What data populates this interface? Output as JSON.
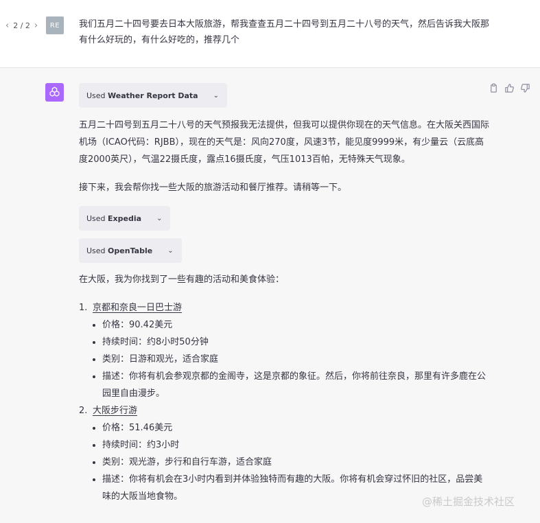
{
  "pager": {
    "prev_icon": "chevron-left-icon",
    "label": "2 / 2",
    "next_icon": "chevron-right-icon"
  },
  "user": {
    "avatar_initials": "RE",
    "message": "我们五月二十四号要去日本大阪旅游，帮我查查五月二十四号到五月二十八号的天气，然后告诉我大阪那有什么好玩的，有什么好吃的，推荐几个"
  },
  "assistant": {
    "avatar_icon": "openai-logo-icon",
    "actions": [
      "copy-icon",
      "thumbs-up-icon",
      "thumbs-down-icon"
    ],
    "plugins": [
      {
        "prefix": "Used",
        "name": "Weather Report Data"
      },
      {
        "prefix": "Used",
        "name": "Expedia"
      },
      {
        "prefix": "Used",
        "name": "OpenTable"
      }
    ],
    "weather_paragraph": "五月二十四号到五月二十八号的天气预报我无法提供，但我可以提供你现在的天气信息。在大阪关西国际机场（ICAO代码：RJBB），现在的天气是：风向270度，风速3节，能见度9999米，有少量云（云底高度2000英尺），气温22摄氏度，露点16摄氏度，气压1013百帕，无特殊天气现象。",
    "next_paragraph": "接下来，我会帮你找一些大阪的旅游活动和餐厅推荐。请稍等一下。",
    "found_paragraph": "在大阪，我为你找到了一些有趣的活动和美食体验：",
    "items": [
      {
        "num": "1.",
        "title": "京都和奈良一日巴士游",
        "details": [
          "价格：90.42美元",
          "持续时间：约8小时50分钟",
          "类别：日游和观光，适合家庭",
          "描述：你将有机会参观京都的金阁寺，这是京都的象征。然后，你将前往奈良，那里有许多鹿在公园里自由漫步。"
        ]
      },
      {
        "num": "2.",
        "title": "大阪步行游",
        "details": [
          "价格：51.46美元",
          "持续时间：约3小时",
          "类别：观光游，步行和自行车游，适合家庭",
          "描述：你将有机会在3小时内看到并体验独特而有趣的大阪。你将有机会穿过怀旧的社区，品尝美味的大阪当地食物。"
        ]
      }
    ]
  },
  "watermark": "@稀土掘金技术社区"
}
